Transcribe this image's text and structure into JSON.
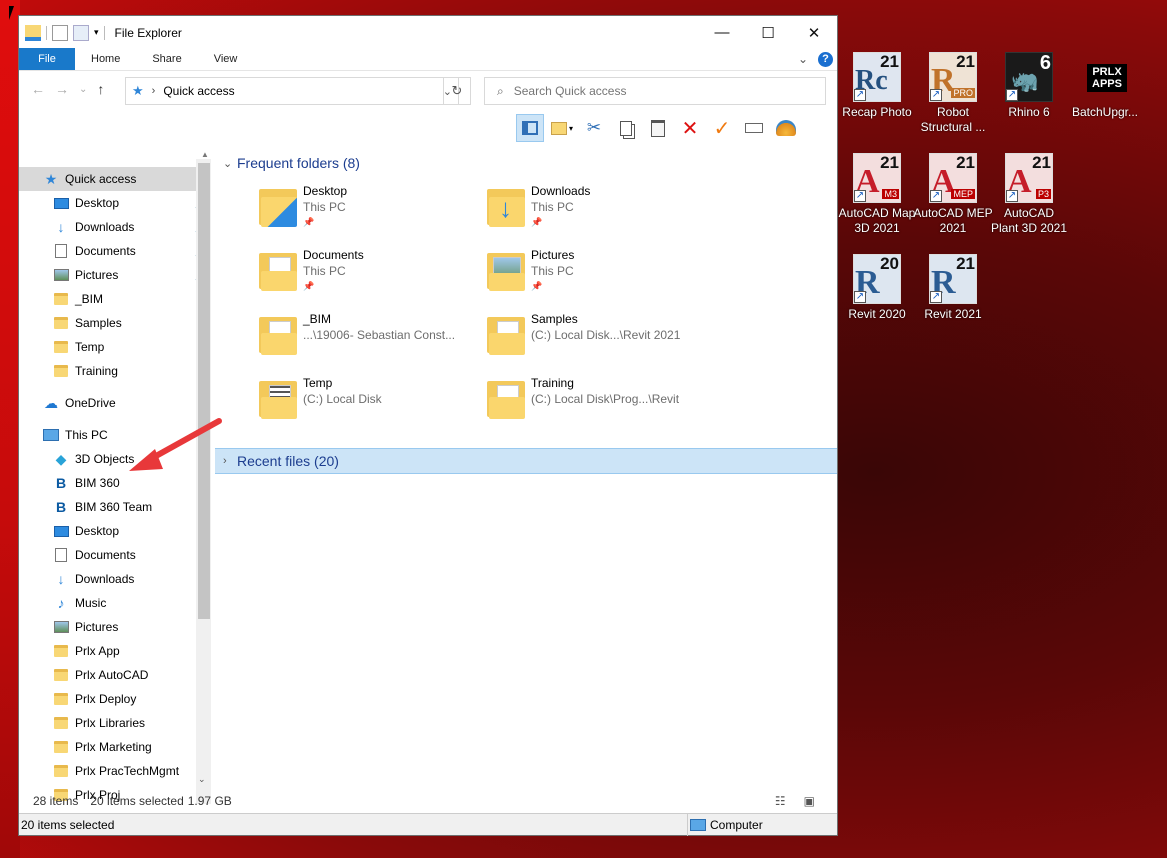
{
  "window": {
    "title": "File Explorer",
    "controls": {
      "minimize": "—",
      "maximize": "☐",
      "close": "✕"
    }
  },
  "ribbon": {
    "tabs": [
      "File",
      "Home",
      "Share",
      "View"
    ],
    "collapse_glyph": "⌄",
    "help_glyph": "?"
  },
  "address": {
    "path": "Quick access",
    "separator": "›",
    "dropdown_glyph": "⌄",
    "refresh_glyph": "↻",
    "back_glyph": "←",
    "forward_glyph": "→",
    "recent_glyph": "⌄",
    "up_glyph": "↑"
  },
  "search": {
    "placeholder": "Search Quick access"
  },
  "toolbar": {
    "icons": [
      "preview-pane-icon",
      "new-folder-icon",
      "cut-icon",
      "copy-icon",
      "paste-icon",
      "delete-icon",
      "checkmark-icon",
      "rename-icon",
      "shell-icon"
    ]
  },
  "navpane": {
    "quick_access": "Quick access",
    "quick_items": [
      {
        "label": "Desktop",
        "pinned": true
      },
      {
        "label": "Downloads",
        "pinned": true
      },
      {
        "label": "Documents",
        "pinned": true
      },
      {
        "label": "Pictures",
        "pinned": true
      },
      {
        "label": "_BIM",
        "pinned": false
      },
      {
        "label": "Samples",
        "pinned": false
      },
      {
        "label": "Temp",
        "pinned": false
      },
      {
        "label": "Training",
        "pinned": false
      }
    ],
    "onedrive": "OneDrive",
    "this_pc": "This PC",
    "pc_items": [
      "3D Objects",
      "BIM 360",
      "BIM 360 Team",
      "Desktop",
      "Documents",
      "Downloads",
      "Music",
      "Pictures",
      "Prlx App",
      "Prlx AutoCAD",
      "Prlx Deploy",
      "Prlx Libraries",
      "Prlx Marketing",
      "Prlx PracTechMgmt",
      "Prlx Proj"
    ]
  },
  "content": {
    "frequent_header": "Frequent folders (8)",
    "recent_header": "Recent files (20)",
    "folders": [
      {
        "name": "Desktop",
        "sub": "This PC",
        "pinned": true
      },
      {
        "name": "Downloads",
        "sub": "This PC",
        "pinned": true
      },
      {
        "name": "Documents",
        "sub": "This PC",
        "pinned": true
      },
      {
        "name": "Pictures",
        "sub": "This PC",
        "pinned": true
      },
      {
        "name": "_BIM",
        "sub": "...\\19006- Sebastian Const...",
        "pinned": false
      },
      {
        "name": "Samples",
        "sub": "(C:) Local Disk...\\Revit 2021",
        "pinned": false
      },
      {
        "name": "Temp",
        "sub": "(C:) Local Disk",
        "pinned": false
      },
      {
        "name": "Training",
        "sub": "(C:) Local Disk\\Prog...\\Revit",
        "pinned": false
      }
    ]
  },
  "status": {
    "items": "28 items",
    "selected": "20 items selected",
    "size": "1.97 GB",
    "bottom_left": "20 items selected",
    "bottom_right": "Computer"
  },
  "desktop": {
    "icons": [
      {
        "label": "Recap Photo",
        "letter": "Rc",
        "version": "21",
        "sub": ""
      },
      {
        "label": "Robot Structural ...",
        "letter": "R",
        "version": "21",
        "sub": "PRO"
      },
      {
        "label": "Rhino 6",
        "letter": "",
        "version": "6",
        "sub": ""
      },
      {
        "label": "BatchUpgr...",
        "letter": "PRLX APPS",
        "version": "",
        "sub": ""
      },
      {
        "label": "AutoCAD Map 3D 2021",
        "letter": "A",
        "version": "21",
        "sub": "M3"
      },
      {
        "label": "AutoCAD MEP 2021",
        "letter": "A",
        "version": "21",
        "sub": "MEP"
      },
      {
        "label": "AutoCAD Plant 3D 2021",
        "letter": "A",
        "version": "21",
        "sub": "P3"
      },
      {
        "label": "Revit 2020",
        "letter": "R",
        "version": "20",
        "sub": ""
      },
      {
        "label": "Revit 2021",
        "letter": "R",
        "version": "21",
        "sub": ""
      }
    ]
  },
  "colors": {
    "accent": "#1979ca",
    "selection": "#cce4f7",
    "desktop": "#8a0a0a"
  }
}
